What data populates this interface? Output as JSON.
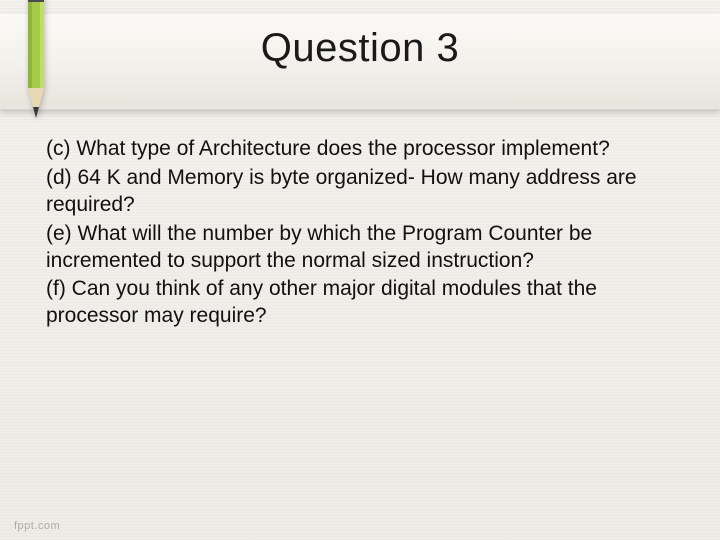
{
  "title": "Question 3",
  "items": {
    "c": "(c) What type of Architecture does the processor implement?",
    "d": "(d) 64 K and Memory is byte organized- How many address are required?",
    "e": "(e) What will the number by which the Program Counter be incremented to support the normal sized instruction?",
    "f": "(f) Can you think of any other major digital modules that the processor may require?"
  },
  "watermark": "fppt.com"
}
